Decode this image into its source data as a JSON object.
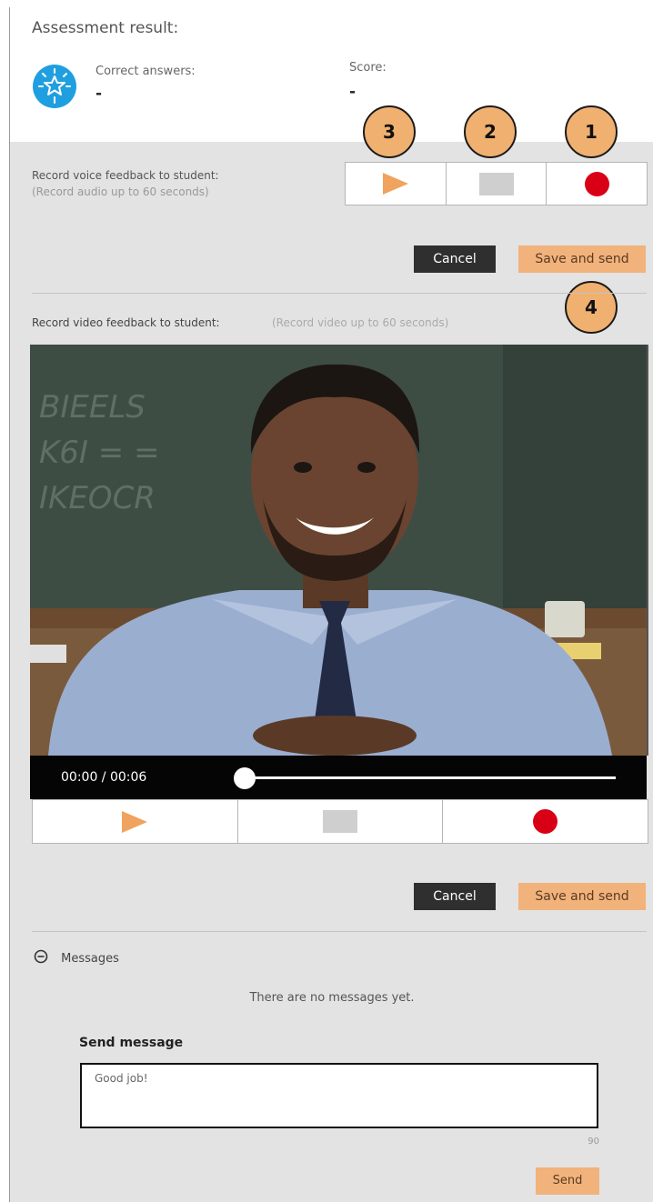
{
  "assessment": {
    "title": "Assessment result:",
    "correct_label": "Correct answers:",
    "correct_value": "-",
    "score_label": "Score:",
    "score_value": "-",
    "badge_icon": "star-badge-icon"
  },
  "steps": {
    "one": "1",
    "two": "2",
    "three": "3",
    "four": "4"
  },
  "voice": {
    "label": "Record voice feedback to student:",
    "hint": "(Record audio up to 60 seconds)",
    "cancel": "Cancel",
    "save": "Save and send",
    "controls": [
      "play-icon",
      "stop-icon",
      "record-icon"
    ]
  },
  "video": {
    "label": "Record video feedback to student:",
    "hint": "(Record video up to 60 seconds)",
    "time": "00:00 / 00:06",
    "progress": 0,
    "board_text": [
      "BIEELS",
      "K6I = =",
      "IKEOCR"
    ],
    "cancel": "Cancel",
    "save": "Save and send",
    "controls": [
      "play-icon",
      "stop-icon",
      "record-icon"
    ]
  },
  "messages": {
    "header": "Messages",
    "empty": "There are no messages yet.",
    "send_title": "Send message",
    "input_value": "Good job!",
    "char_count": "90",
    "send": "Send"
  },
  "colors": {
    "accent": "#f1b27c",
    "record": "#d90016",
    "badge": "#1f9fe0",
    "panel": "#e3e3e3"
  }
}
